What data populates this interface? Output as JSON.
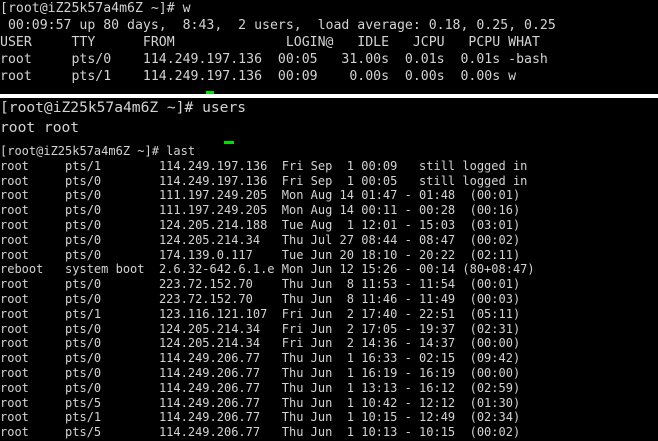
{
  "terminal": {
    "panel1": [
      "[root@iZ25k57a4m6Z ~]# w",
      " 00:09:57 up 80 days,  8:43,  2 users,  load average: 0.18, 0.25, 0.25",
      "USER     TTY      FROM              LOGIN@   IDLE   JCPU   PCPU WHAT",
      "root     pts/0    114.249.197.136  00:05   31.00s  0.01s  0.01s -bash",
      "root     pts/1    114.249.197.136  00:09    0.00s  0.00s  0.00s w"
    ],
    "panel2": [
      "[root@iZ25k57a4m6Z ~]# users",
      "root root"
    ],
    "panel3": [
      "[root@iZ25k57a4m6Z ~]# last",
      "root     pts/1        114.249.197.136  Fri Sep  1 00:09   still logged in",
      "root     pts/0        114.249.197.136  Fri Sep  1 00:05   still logged in",
      "root     pts/0        111.197.249.205  Mon Aug 14 01:47 - 01:48  (00:01)",
      "root     pts/0        111.197.249.205  Mon Aug 14 00:11 - 00:28  (00:16)",
      "root     pts/0        124.205.214.188  Tue Aug  1 12:01 - 15:03  (03:01)",
      "root     pts/0        124.205.214.34   Thu Jul 27 08:44 - 08:47  (00:02)",
      "root     pts/0        174.139.0.117    Tue Jun 20 18:10 - 20:22  (02:11)",
      "reboot   system boot  2.6.32-642.6.1.e Mon Jun 12 15:26 - 00:14 (80+08:47)",
      "root     pts/0        223.72.152.70    Thu Jun  8 11:53 - 11:54  (00:01)",
      "root     pts/0        223.72.152.70    Thu Jun  8 11:46 - 11:49  (00:03)",
      "root     pts/1        123.116.121.107  Fri Jun  2 17:40 - 22:51  (05:11)",
      "root     pts/0        124.205.214.34   Fri Jun  2 17:05 - 19:37  (02:31)",
      "root     pts/0        124.205.214.34   Fri Jun  2 14:36 - 14:37  (00:00)",
      "root     pts/0        114.249.206.77   Thu Jun  1 16:33 - 02:15  (09:42)",
      "root     pts/0        114.249.206.77   Thu Jun  1 16:19 - 16:19  (00:00)",
      "root     pts/0        114.249.206.77   Thu Jun  1 13:13 - 16:12  (02:59)",
      "root     pts/5        114.249.206.77   Thu Jun  1 10:42 - 12:12  (01:30)",
      "root     pts/1        114.249.206.77   Thu Jun  1 10:15 - 12:49  (02:34)",
      "root     pts/5        114.249.206.77   Thu Jun  1 10:13 - 10:15  (00:02)"
    ]
  },
  "colors": {
    "background": "#000000",
    "foreground": "#d3d3d3",
    "cursor": "#00e000",
    "separator": "#ffffff"
  }
}
